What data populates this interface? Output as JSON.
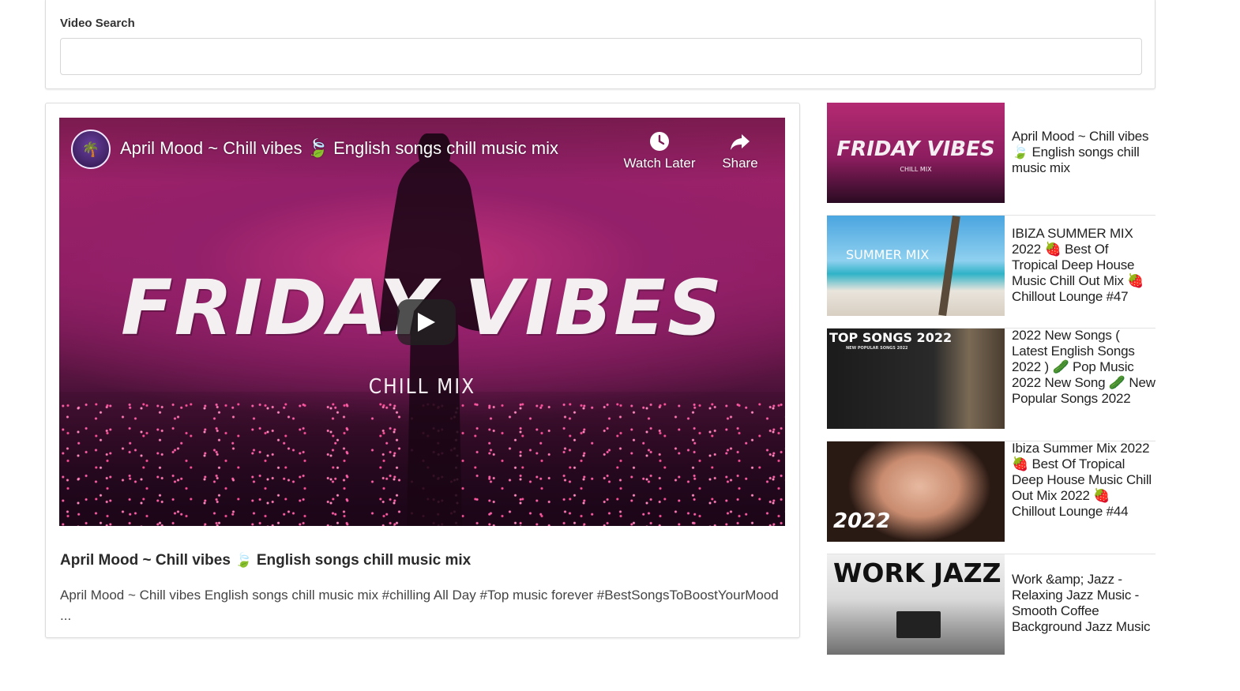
{
  "search": {
    "label": "Video Search",
    "value": "",
    "placeholder": ""
  },
  "player": {
    "title": "April Mood ~ Chill vibes 🍃 English songs chill music mix",
    "watch_later_label": "Watch Later",
    "share_label": "Share",
    "art_title": "FRIDAY VIBES",
    "art_subtitle": "CHILL MIX"
  },
  "video": {
    "title_text": "April Mood ~ Chill vibes",
    "title_emoji": "🍃",
    "title_rest": "English songs chill music mix",
    "description": "April Mood ~ Chill vibes English songs chill music mix #chilling All Day #Top music forever #BestSongsToBoostYourMood ..."
  },
  "sidebar": {
    "items": [
      {
        "title": "April Mood ~ Chill vibes 🍃 English songs chill music mix",
        "thumb_text": "FRIDAY VIBES",
        "thumb_sub": "CHILL MIX"
      },
      {
        "title": "IBIZA SUMMER MIX 2022 🍓 Best Of Tropical Deep House Music Chill Out Mix 🍓 Chillout Lounge #47",
        "thumb_text": "SUMMER MIX"
      },
      {
        "title": "2022 New Songs ( Latest English Songs 2022 ) 🥒 Pop Music 2022 New Song 🥒 New Popular Songs 2022",
        "thumb_text": "TOP SONGS 2022",
        "thumb_sub": "NEW POPULAR SONGS 2022"
      },
      {
        "title": "Ibiza Summer Mix 2022 🍓 Best Of Tropical Deep House Music Chill Out Mix 2022 🍓 Chillout Lounge #44",
        "thumb_text": "2022"
      },
      {
        "title": "Work &amp; Jazz - Relaxing Jazz Music - Smooth Coffee Background Jazz Music",
        "thumb_text": "WORK JAZZ"
      }
    ]
  }
}
